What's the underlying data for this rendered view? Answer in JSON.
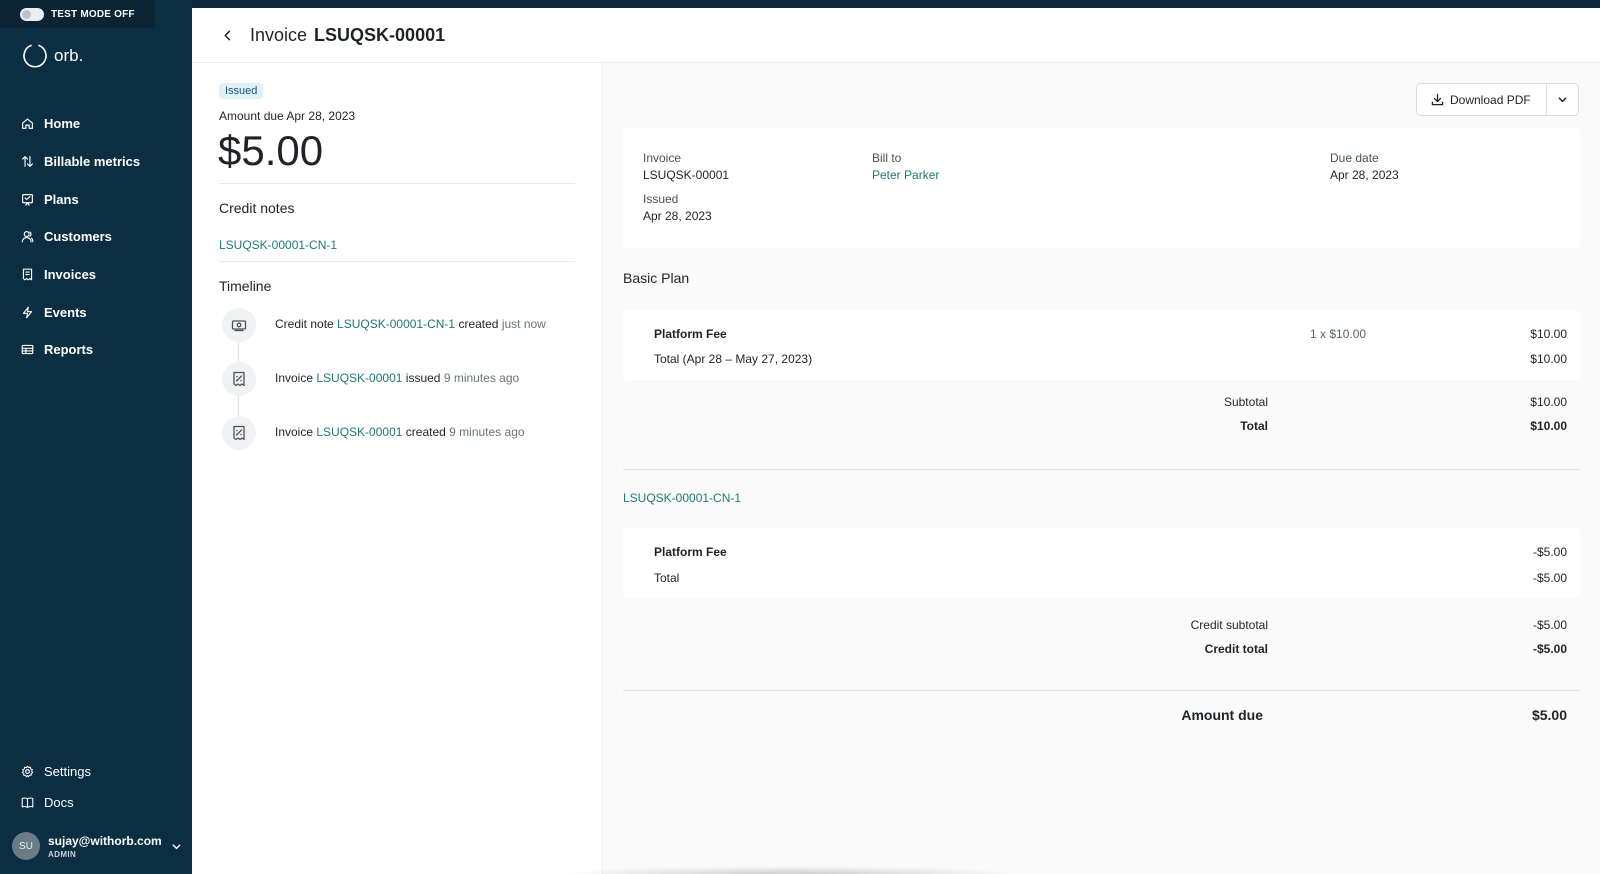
{
  "test_mode": {
    "label": "TEST MODE OFF"
  },
  "brand": {
    "name": "orb."
  },
  "nav": {
    "items": [
      {
        "label": "Home",
        "icon": "home-icon"
      },
      {
        "label": "Billable metrics",
        "icon": "arrows-up-down-icon"
      },
      {
        "label": "Plans",
        "icon": "plans-icon"
      },
      {
        "label": "Customers",
        "icon": "users-icon"
      },
      {
        "label": "Invoices",
        "icon": "receipt-icon"
      },
      {
        "label": "Events",
        "icon": "bolt-icon"
      },
      {
        "label": "Reports",
        "icon": "table-icon"
      }
    ],
    "bottom": [
      {
        "label": "Settings",
        "icon": "gear-icon"
      },
      {
        "label": "Docs",
        "icon": "book-icon"
      }
    ]
  },
  "user": {
    "initials": "SU",
    "email": "sujay@withorb.com",
    "role": "ADMIN"
  },
  "header": {
    "label": "Invoice",
    "number": "LSUQSK-00001"
  },
  "summary": {
    "status": "Issued",
    "amount_due_label": "Amount due Apr 28, 2023",
    "amount": "$5.00",
    "credit_notes_title": "Credit notes",
    "credit_note_link": "LSUQSK-00001-CN-1",
    "timeline_title": "Timeline",
    "timeline": [
      {
        "prefix": "Credit note",
        "link": "LSUQSK-00001-CN-1",
        "action": "created",
        "time": "just now",
        "icon": "cash-icon"
      },
      {
        "prefix": "Invoice",
        "link": "LSUQSK-00001",
        "action": "issued",
        "time": "9 minutes ago",
        "icon": "receipt-percent-icon"
      },
      {
        "prefix": "Invoice",
        "link": "LSUQSK-00001",
        "action": "created",
        "time": "9 minutes ago",
        "icon": "receipt-percent-icon"
      }
    ]
  },
  "document": {
    "download_label": "Download PDF",
    "invoice_label": "Invoice",
    "invoice_number": "LSUQSK-00001",
    "issued_label": "Issued",
    "issued_date": "Apr 28, 2023",
    "bill_to_label": "Bill to",
    "bill_to_name": "Peter Parker",
    "due_date_label": "Due date",
    "due_date": "Apr 28, 2023",
    "plan_name": "Basic Plan",
    "plan_line": {
      "name": "Platform Fee",
      "qty": "1 x $10.00",
      "amount": "$10.00"
    },
    "plan_total": {
      "label": "Total (Apr 28 – May 27, 2023)",
      "amount": "$10.00"
    },
    "subtotal": {
      "label": "Subtotal",
      "amount": "$10.00"
    },
    "total": {
      "label": "Total",
      "amount": "$10.00"
    },
    "credit_note_link": "LSUQSK-00001-CN-1",
    "credit_line": {
      "name": "Platform Fee",
      "amount": "-$5.00"
    },
    "credit_line_total": {
      "label": "Total",
      "amount": "-$5.00"
    },
    "credit_subtotal": {
      "label": "Credit subtotal",
      "amount": "-$5.00"
    },
    "credit_total": {
      "label": "Credit total",
      "amount": "-$5.00"
    },
    "amount_due": {
      "label": "Amount due",
      "amount": "$5.00"
    }
  },
  "colors": {
    "sidebar": "#0b2e42",
    "link": "#1f7a6f",
    "badge_bg": "#e2f0f8",
    "badge_text": "#11567e"
  }
}
